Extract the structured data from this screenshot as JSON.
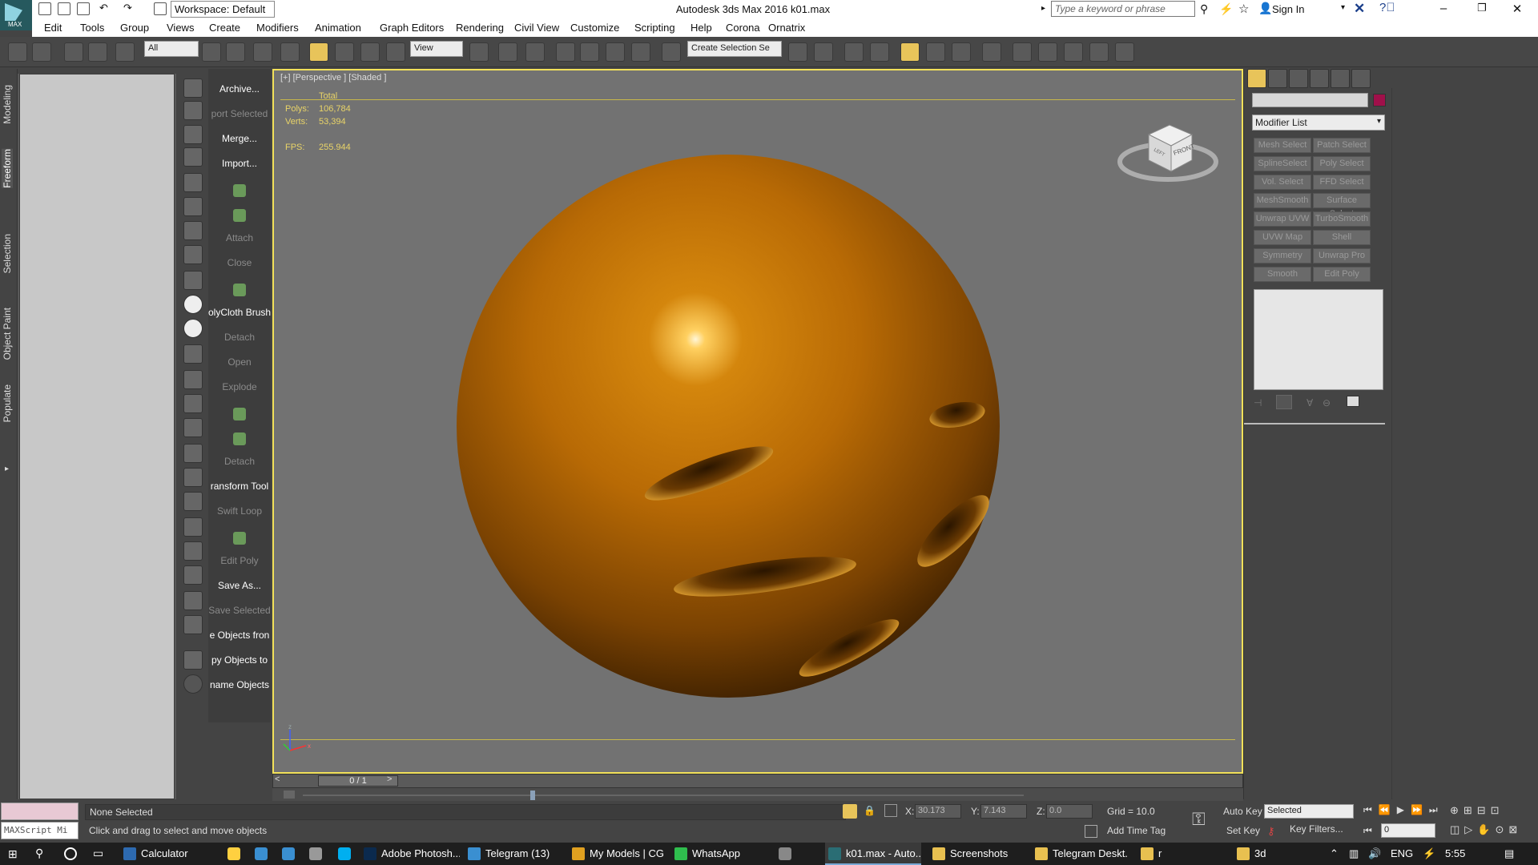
{
  "window": {
    "title": "Autodesk 3ds Max 2016      k01.max",
    "logo_text": "MAX"
  },
  "workspace": "Workspace: Default",
  "search": {
    "placeholder": "Type a keyword or phrase"
  },
  "signin": "Sign In",
  "menu": [
    "Edit",
    "Tools",
    "Group",
    "Views",
    "Create",
    "Modifiers",
    "Animation",
    "Graph Editors",
    "Rendering",
    "Civil View",
    "Customize",
    "Scripting",
    "Help",
    "Corona",
    "Ornatrix"
  ],
  "toolbar": {
    "filter": "All",
    "refcoord": "View",
    "selset": "Create Selection Se"
  },
  "ribbon_tabs": [
    "Modeling",
    "Freeform",
    "Selection",
    "Object Paint",
    "Populate"
  ],
  "commands": [
    {
      "label": "Archive...",
      "enabled": true
    },
    {
      "label": "port Selected",
      "enabled": false
    },
    {
      "label": "Merge...",
      "enabled": true
    },
    {
      "label": "Import...",
      "enabled": true
    },
    {
      "label": "",
      "enabled": true
    },
    {
      "label": "",
      "enabled": true
    },
    {
      "label": "Attach",
      "enabled": false
    },
    {
      "label": "Close",
      "enabled": false
    },
    {
      "label": "",
      "enabled": true
    },
    {
      "label": "olyCloth Brush",
      "enabled": true
    },
    {
      "label": "Detach",
      "enabled": false
    },
    {
      "label": "Open",
      "enabled": false
    },
    {
      "label": "Explode",
      "enabled": false
    },
    {
      "label": "",
      "enabled": true
    },
    {
      "label": "",
      "enabled": true
    },
    {
      "label": "Detach",
      "enabled": false
    },
    {
      "label": "ransform Tool",
      "enabled": true
    },
    {
      "label": "Swift Loop",
      "enabled": false
    },
    {
      "label": "",
      "enabled": true
    },
    {
      "label": "Edit Poly",
      "enabled": false
    },
    {
      "label": "Save As...",
      "enabled": true
    },
    {
      "label": "Save Selected",
      "enabled": false
    },
    {
      "label": "e Objects fron",
      "enabled": true
    },
    {
      "label": "py Objects to",
      "enabled": true
    },
    {
      "label": "name Objects",
      "enabled": true
    }
  ],
  "viewport": {
    "label": "[+] [Perspective ] [Shaded ]",
    "stats": {
      "header": "Total",
      "polys_label": "Polys:",
      "polys": "106,784",
      "verts_label": "Verts:",
      "verts": "53,394",
      "fps_label": "FPS:",
      "fps": "255.944"
    },
    "navcube_face": "FRONT",
    "navcube_side": "LEFT",
    "object_color": "#c37b0a",
    "background_color": "#727272"
  },
  "timeslider": {
    "frame": "0 / 1"
  },
  "modifier_list": {
    "label": "Modifier List",
    "buttons": [
      "Mesh Select",
      "Patch Select",
      "SplineSelect",
      "Poly Select",
      "Vol. Select",
      "FFD Select",
      "MeshSmooth",
      "Surface Select",
      "Unwrap UVW",
      "TurboSmooth",
      "UVW Map",
      "Shell",
      "Symmetry",
      "Unwrap Pro",
      "Smooth",
      "Edit Poly"
    ]
  },
  "status": {
    "maxscript": "MAXScript Mi",
    "selection": "None Selected",
    "prompt": "Click and drag to select and move objects",
    "x_label": "X:",
    "x": "30.173",
    "y_label": "Y:",
    "y": "7.143",
    "z_label": "Z:",
    "z": "0.0",
    "grid": "Grid = 10.0",
    "add_time_tag": "Add Time Tag",
    "auto_key": "Auto Key",
    "set_key": "Set Key",
    "selected": "Selected",
    "key_filters": "Key Filters...",
    "frame": "0"
  },
  "taskbar": {
    "items": [
      {
        "label": "Calculator",
        "color": "#2d6ab0"
      },
      {
        "label": "Adobe Photosh...",
        "color": "#0b2a4e"
      },
      {
        "label": "Telegram (13)",
        "color": "#3a8fd1"
      },
      {
        "label": "My Models | CG...",
        "color": "#e0a020"
      },
      {
        "label": "WhatsApp",
        "color": "#2fbe4e"
      },
      {
        "label": "k01.max - Auto...",
        "color": "#2a6d74"
      },
      {
        "label": "Screenshots",
        "color": "#e8c050"
      },
      {
        "label": "Telegram Deskt...",
        "color": "#e8c050"
      },
      {
        "label": "r",
        "color": "#e8c050"
      },
      {
        "label": "3d",
        "color": "#e8c050"
      }
    ],
    "lang": "ENG",
    "time": "5:55 PM"
  },
  "colors": {
    "accent": "#f2e15a",
    "viewport_border": "#f2e15a"
  }
}
